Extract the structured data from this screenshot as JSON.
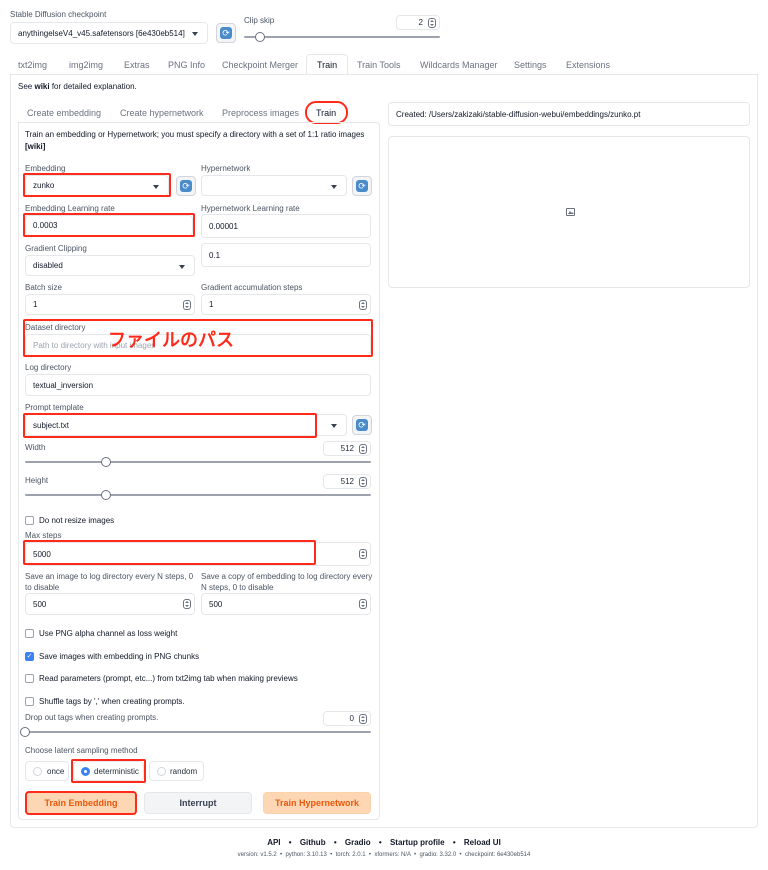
{
  "header": {
    "checkpoint_label": "Stable Diffusion checkpoint",
    "checkpoint_value": "anythingelseV4_v45.safetensors [6e430eb514]",
    "clip_skip_label": "Clip skip",
    "clip_skip_value": "2",
    "clip_skip_fraction": 0.08
  },
  "main_tabs": [
    "txt2img",
    "img2img",
    "Extras",
    "PNG Info",
    "Checkpoint Merger",
    "Train",
    "Train Tools",
    "Wildcards Manager",
    "Settings",
    "Extensions"
  ],
  "active_main_tab": "Train",
  "wiki_note": {
    "prefix": "See ",
    "link": "wiki",
    "suffix": " for detailed explanation."
  },
  "sub_tabs": [
    "Create embedding",
    "Create hypernetwork",
    "Preprocess images",
    "Train"
  ],
  "intro": {
    "text": "Train an embedding or Hypernetwork; you must specify a directory with a set of 1:1 ratio images",
    "wiki": "[wiki]"
  },
  "form": {
    "embedding_label": "Embedding",
    "embedding_value": "zunko",
    "hypernetwork_label": "Hypernetwork",
    "hypernetwork_value": "",
    "emb_lr_label": "Embedding Learning rate",
    "emb_lr_value": "0.0003",
    "hn_lr_label": "Hypernetwork Learning rate",
    "hn_lr_value": "0.00001",
    "grad_clip_label": "Gradient Clipping",
    "grad_clip_value": "disabled",
    "grad_clip_num": "0.1",
    "batch_label": "Batch size",
    "batch_value": "1",
    "grad_acc_label": "Gradient accumulation steps",
    "grad_acc_value": "1",
    "dataset_label": "Dataset directory",
    "dataset_placeholder": "Path to directory with input images",
    "dataset_annotation": "ファイルのパス",
    "log_label": "Log directory",
    "log_value": "textual_inversion",
    "prompt_label": "Prompt template",
    "prompt_value": "subject.txt",
    "width_label": "Width",
    "width_value": "512",
    "width_fraction": 0.235,
    "height_label": "Height",
    "height_value": "512",
    "height_fraction": 0.235,
    "no_resize_label": "Do not resize images",
    "max_steps_label": "Max steps",
    "max_steps_value": "5000",
    "save_img_label": "Save an image to log directory every N steps, 0 to disable",
    "save_img_value": "500",
    "save_emb_label": "Save a copy of embedding to log directory every N steps, 0 to disable",
    "save_emb_value": "500",
    "png_alpha_label": "Use PNG alpha channel as loss weight",
    "save_png_label": "Save images with embedding in PNG chunks",
    "read_params_label": "Read parameters (prompt, etc...) from txt2img tab when making previews",
    "shuffle_label": "Shuffle tags by ',' when creating prompts.",
    "dropout_label": "Drop out tags when creating prompts.",
    "dropout_value": "0",
    "dropout_fraction": 0.0,
    "latent_label": "Choose latent sampling method",
    "latent_options": [
      "once",
      "deterministic",
      "random"
    ],
    "latent_selected": "deterministic"
  },
  "buttons": {
    "train_embedding": "Train Embedding",
    "interrupt": "Interrupt",
    "train_hypernetwork": "Train Hypernetwork"
  },
  "output": {
    "status": "Created: /Users/zakizaki/stable-diffusion-webui/embeddings/zunko.pt"
  },
  "footer": {
    "links": [
      "API",
      "Github",
      "Gradio",
      "Startup profile",
      "Reload UI"
    ],
    "version_text": "version: v1.5.2  •  python: 3.10.13  •  torch: 2.0.1  •  xformers: N/A  •  gradio: 3.32.0  •  checkpoint: 6e430eb514"
  },
  "colors": {
    "annotation_red": "#ff2a1a",
    "orange_button": "#fdd7b4",
    "orange_text": "#ea580c",
    "accent_blue": "#3b82f6"
  }
}
